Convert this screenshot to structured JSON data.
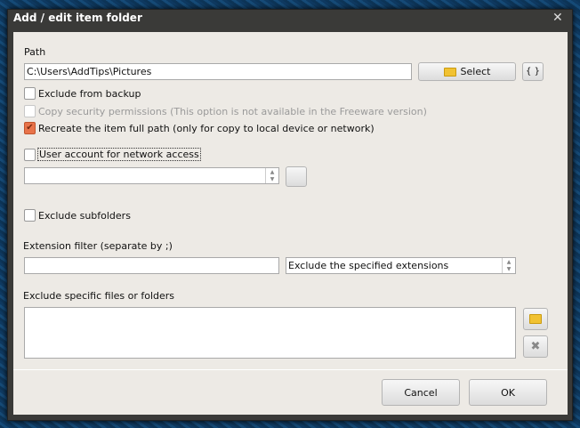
{
  "window": {
    "title": "Add / edit item folder",
    "close_label": "✕"
  },
  "path": {
    "label": "Path",
    "value": "C:\\Users\\AddTips\\Pictures",
    "select_label": "Select",
    "variables_label": "{ }"
  },
  "options": [
    {
      "label": "Exclude from backup",
      "checked": false,
      "disabled": false
    },
    {
      "label": "Copy security permissions (This option is not available in the Freeware version)",
      "checked": false,
      "disabled": true
    },
    {
      "label": "Recreate the item full path (only for copy to local device or network)",
      "checked": true,
      "disabled": false
    }
  ],
  "network": {
    "label": "User account for network access",
    "checked": false,
    "account_value": ""
  },
  "subfolders": {
    "label": "Exclude subfolders",
    "checked": false
  },
  "extension": {
    "label": "Extension filter (separate by ;)",
    "value": "",
    "mode": "Exclude the specified extensions"
  },
  "exclude": {
    "label": "Exclude specific files or folders"
  },
  "footer": {
    "cancel": "Cancel",
    "ok": "OK"
  },
  "colors": {
    "accent": "#e8734a",
    "title_bar": "#3a3a38",
    "content_bg": "#edeae5"
  }
}
